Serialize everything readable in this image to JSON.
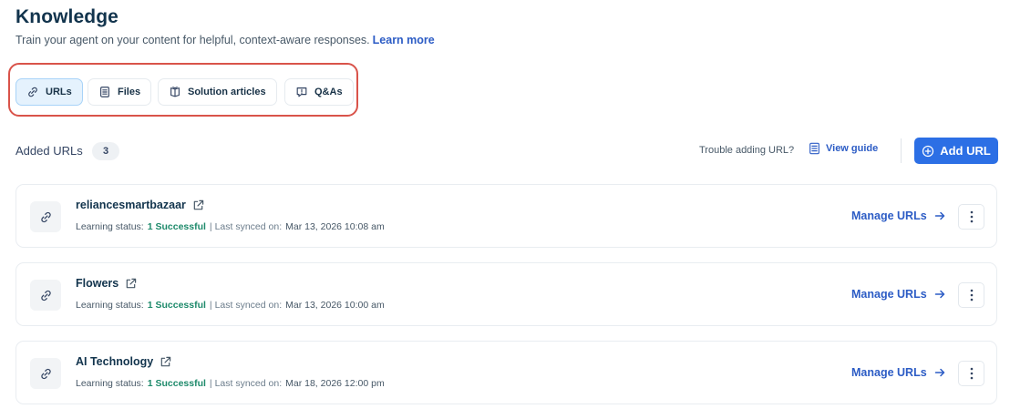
{
  "header": {
    "title": "Knowledge",
    "subtitle": "Train your agent on your content for helpful, context-aware responses.",
    "learn_more": "Learn more"
  },
  "tabs": [
    {
      "label": "URLs",
      "icon": "link-icon",
      "active": true
    },
    {
      "label": "Files",
      "icon": "file-icon",
      "active": false
    },
    {
      "label": "Solution articles",
      "icon": "book-icon",
      "active": false
    },
    {
      "label": "Q&As",
      "icon": "chat-bubble-icon",
      "active": false
    }
  ],
  "list_header": {
    "label": "Added URLs",
    "count": "3",
    "trouble_text": "Trouble adding URL?",
    "view_guide": "View guide",
    "add_button": "Add URL"
  },
  "colors": {
    "accent": "#2c6fe5",
    "link": "#2c5cc5",
    "success": "#1e8a6b",
    "highlight_border": "#d9534a"
  },
  "urls": [
    {
      "name": "reliancesmartbazaar",
      "status_label": "Learning status:",
      "status_value": "1 Successful",
      "synced_label": "| Last synced on:",
      "synced_value": "Mar 13, 2026 10:08 am",
      "manage_label": "Manage URLs"
    },
    {
      "name": "Flowers",
      "status_label": "Learning status:",
      "status_value": "1 Successful",
      "synced_label": "| Last synced on:",
      "synced_value": "Mar 13, 2026 10:00 am",
      "manage_label": "Manage URLs"
    },
    {
      "name": "AI Technology",
      "status_label": "Learning status:",
      "status_value": "1 Successful",
      "synced_label": "| Last synced on:",
      "synced_value": "Mar 18, 2026 12:00 pm",
      "manage_label": "Manage URLs"
    }
  ]
}
